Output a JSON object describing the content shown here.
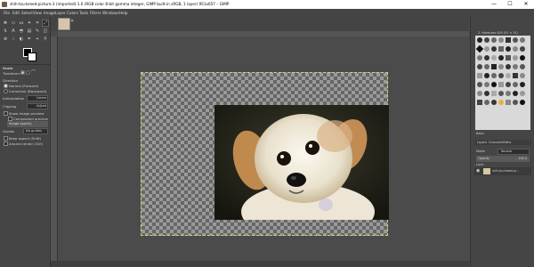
{
  "window": {
    "title": "shih-tzu-breed-picture-3 (imported)-1.0 (RGB color 8-bit gamma integer, GIMP built-in sRGB, 1 layer) 951x657 – GIMP",
    "minimize": "—",
    "maximize": "☐",
    "close": "✕"
  },
  "menu": [
    "File",
    "Edit",
    "Select",
    "View",
    "Image",
    "Layer",
    "Colors",
    "Tools",
    "Filters",
    "Windows",
    "Help"
  ],
  "tool_options": {
    "title": "Scale",
    "transform_label": "Transform:",
    "direction_label": "Direction",
    "direction_normal": "Normal (Forward)",
    "direction_corrective": "Corrective (Backward)",
    "interpolation_label": "Interpolation",
    "interpolation_value": "Linear",
    "clipping_label": "Clipping",
    "clipping_value": "Adjust",
    "show_preview": "Show image preview",
    "composited_preview": "Composited preview",
    "image_opacity": "Image opacity",
    "guides_label": "Guides",
    "guides_value": "No guides",
    "keep_aspect": "Keep aspect (Shift)",
    "around_center": "Around center (Ctrl)"
  },
  "brushes": {
    "title": "2. Hardness 050 (51 × 51)",
    "basic_label": "Basic."
  },
  "layers": {
    "tabs": [
      "Layers",
      "Channels",
      "Paths"
    ],
    "mode_label": "Mode",
    "mode_value": "Normal",
    "opacity_label": "Opacity",
    "opacity_value": "100.0",
    "lock_label": "Lock:",
    "layer_name": "shih-tzu-breed-pi..."
  },
  "colors": {
    "accent": "#d8d06a",
    "panel_bg": "#454545",
    "canvas_bg": "#4b4b4b"
  }
}
